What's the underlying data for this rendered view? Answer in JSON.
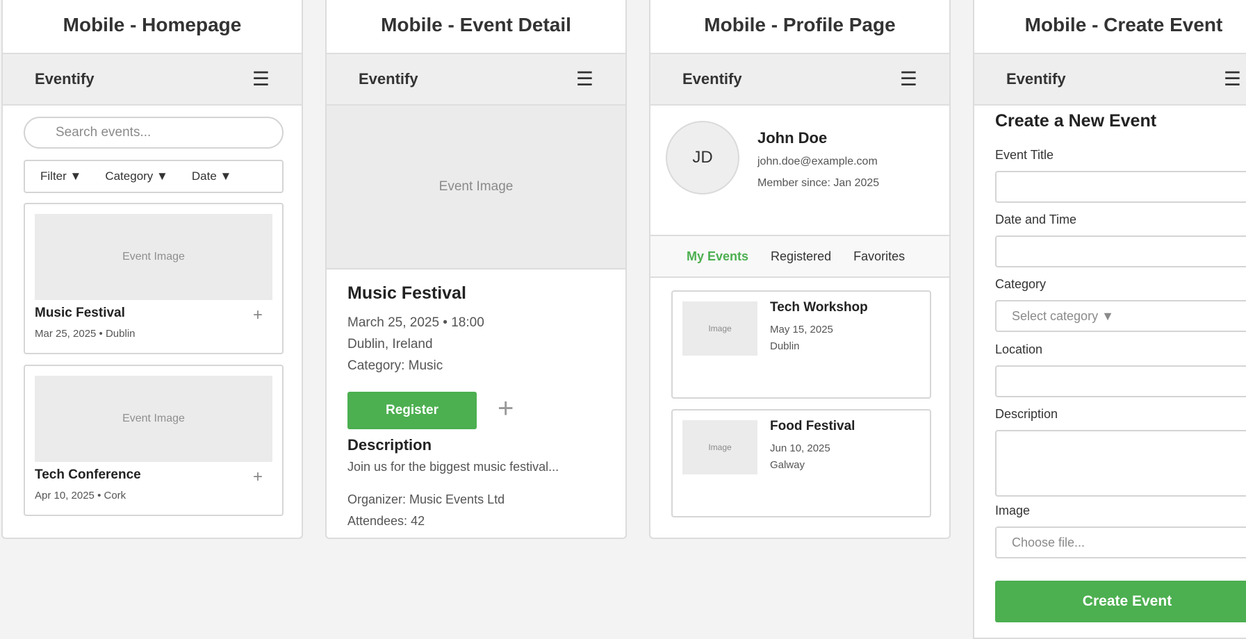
{
  "panels": {
    "homepage": {
      "title": "Mobile - Homepage"
    },
    "event_detail": {
      "title": "Mobile - Event Detail"
    },
    "profile": {
      "title": "Mobile - Profile Page"
    },
    "create_event": {
      "title": "Mobile - Create Event"
    }
  },
  "app": {
    "brand": "Eventify",
    "menu_icon": "☰"
  },
  "homepage": {
    "search_placeholder": "Search events...",
    "filters": [
      "Filter ▼",
      "Category ▼",
      "Date ▼"
    ],
    "cards": [
      {
        "image": "Event Image",
        "title": "Music Festival",
        "meta": "Mar 25, 2025 • Dublin",
        "plus": "+"
      },
      {
        "image": "Event Image",
        "title": "Tech Conference",
        "meta": "Apr 10, 2025 • Cork",
        "plus": "+"
      }
    ]
  },
  "event_detail": {
    "image": "Event Image",
    "title": "Music Festival",
    "datetime": "March 25, 2025 • 18:00",
    "location": "Dublin, Ireland",
    "category": "Category: Music",
    "register_label": "Register",
    "plus": "+",
    "description_heading": "Description",
    "description": "Join us for the biggest music festival...",
    "organizer": "Organizer: Music Events Ltd",
    "attendees": "Attendees: 42"
  },
  "profile": {
    "initials": "JD",
    "name": "John Doe",
    "email": "john.doe@example.com",
    "member_since": "Member since: Jan 2025",
    "tabs": [
      "My Events",
      "Registered",
      "Favorites"
    ],
    "active_tab": "My Events",
    "events": [
      {
        "image": "Image",
        "title": "Tech Workshop",
        "date": "May 15, 2025",
        "location": "Dublin"
      },
      {
        "image": "Image",
        "title": "Food Festival",
        "date": "Jun 10, 2025",
        "location": "Galway"
      }
    ]
  },
  "create_event": {
    "heading": "Create a New Event",
    "labels": {
      "title": "Event Title",
      "datetime": "Date and Time",
      "category": "Category",
      "location": "Location",
      "description": "Description",
      "image": "Image"
    },
    "category_placeholder": "Select category ▼",
    "file_placeholder": "Choose file...",
    "submit_label": "Create Event"
  },
  "colors": {
    "accent": "#4caf50",
    "background": "#f3f3f3",
    "appbar": "#eeeeee"
  }
}
